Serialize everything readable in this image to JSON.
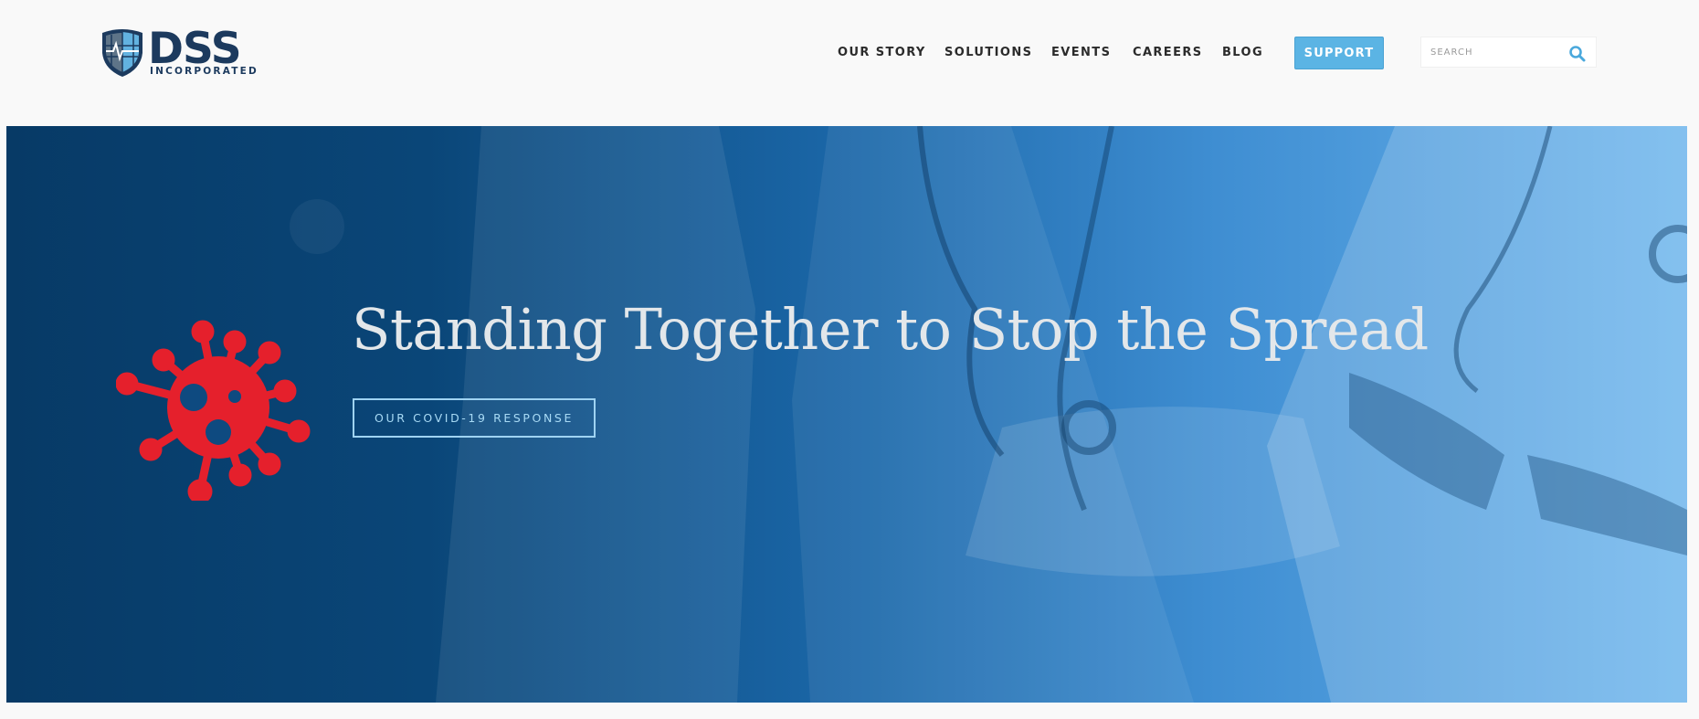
{
  "header": {
    "logo": {
      "name": "DSS",
      "subtitle": "INCORPORATED"
    },
    "nav": [
      {
        "label": "OUR STORY"
      },
      {
        "label": "SOLUTIONS"
      },
      {
        "label": "EVENTS"
      },
      {
        "label": "CAREERS"
      },
      {
        "label": "BLOG"
      }
    ],
    "support_label": "SUPPORT",
    "search": {
      "placeholder": "SEARCH",
      "value": "",
      "icon": "search-icon"
    }
  },
  "hero": {
    "title": "Standing Together to Stop the Spread",
    "cta_label": "OUR COVID-19 RESPONSE",
    "icon": "virus-icon"
  },
  "colors": {
    "brand_navy": "#1c3a5e",
    "accent_blue": "#5bb4e4",
    "hero_dark": "#073a66",
    "hero_light": "#69b3ec",
    "virus_red": "#e5202c"
  }
}
